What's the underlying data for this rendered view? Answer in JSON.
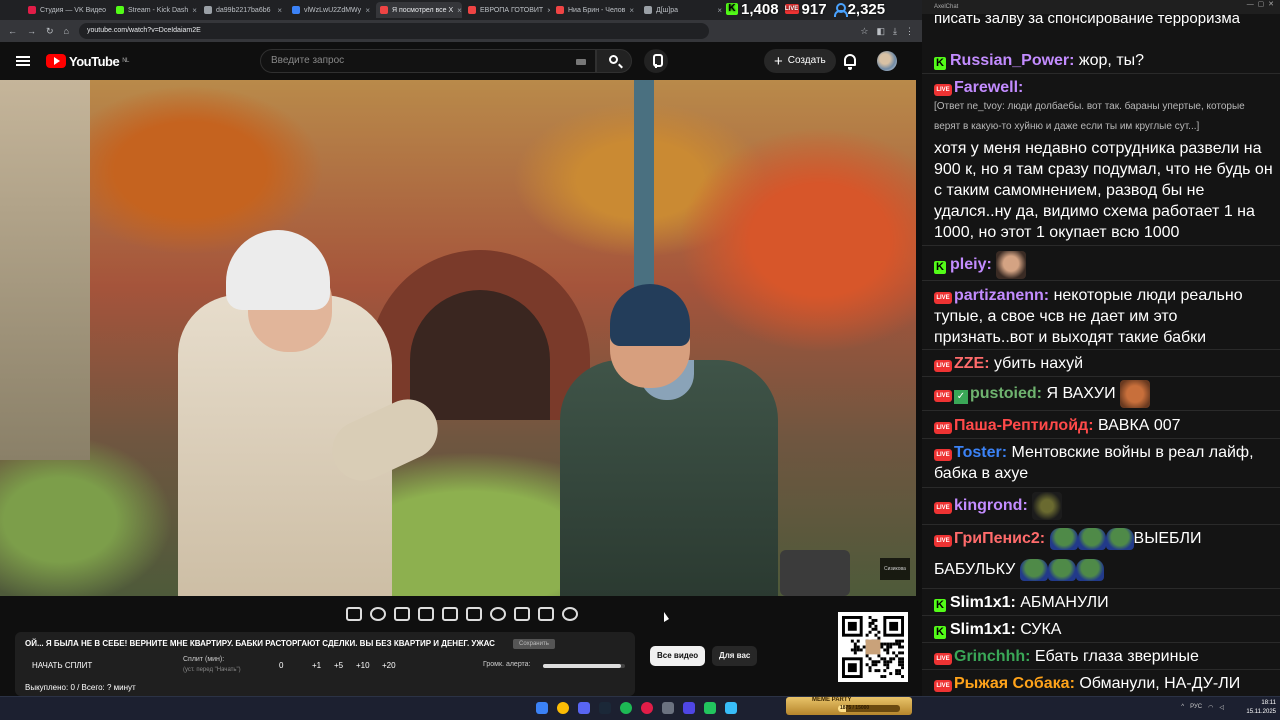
{
  "browser": {
    "tabs": [
      {
        "label": "Студия — VK Видео",
        "color": "#e11d48",
        "active": false
      },
      {
        "label": "Stream - Kick Dash",
        "color": "#53fc18",
        "active": false
      },
      {
        "label": "da99b2217ba6b6",
        "color": "#9aa0a6",
        "active": false
      },
      {
        "label": "vlWzLwU2ZdMWy",
        "color": "#3b82f6",
        "active": false
      },
      {
        "label": "Я посмотрел все Х",
        "color": "#ef4444",
        "active": true
      },
      {
        "label": "ЕВРОПА ГОТОВИТ",
        "color": "#ef4444",
        "active": false
      },
      {
        "label": "Ниа Брин - Челов",
        "color": "#ef4444",
        "active": false
      },
      {
        "label": "Д[ш]ра",
        "color": "#9aa0a6",
        "active": false
      }
    ],
    "url": "youtube.com/watch?v=DceIdaiam2E"
  },
  "stats": {
    "kick_viewers": "1,408",
    "live_viewers": "917",
    "total_viewers": "2,325"
  },
  "youtube": {
    "logo_text": "YouTube",
    "region": "NL",
    "search_placeholder": "Введите запрос",
    "create_label": "Создать"
  },
  "video": {
    "watermark": "Сизикова"
  },
  "panel": {
    "title": "ОЙ... Я БЫЛА НЕ В СЕБЕ! ВЕРНИТЕ МНЕ КВАРТИРУ. БАБКИ РАСТОРГАЮТ СДЕЛКИ. ВЫ БЕЗ КВАРТИР И ДЕНЕГ. УЖАС",
    "saved_button": "Сохранить",
    "split_button": "НАЧАТЬ СПЛИТ",
    "split_label": "Сплит (мин):",
    "split_sub": "(уст. перед \"Начать\")",
    "split_value": "0",
    "increments": [
      "+1",
      "+5",
      "+10",
      "+20"
    ],
    "volume_label": "Громк. алерта:",
    "volume_level": 0.95,
    "bought": "Выкуплено: 0 / Всего: ? минут"
  },
  "chips": {
    "all": "Все видео",
    "for_you": "Для вас"
  },
  "chat": {
    "window_title": "AxelChat",
    "top_cut": "писать залву за спонсирование терроризма",
    "messages": [
      {
        "badge": "kick",
        "user": "Russian_Power:",
        "color": "#c38cff",
        "text": " жор, ты?"
      },
      {
        "badge": "live",
        "user": "Farewell:",
        "color": "#c38cff",
        "text": ""
      },
      {
        "badge": "live",
        "user": "pleiy:",
        "color": "#c38cff",
        "text": ""
      },
      {
        "badge": "live",
        "user": "partizanenn:",
        "color": "#c38cff",
        "text": " некоторые люди реально тупые, а свое чсв не дает им это признать..вот и выходят такие бабки"
      },
      {
        "badge": "live",
        "user": "ZZE:",
        "color": "#ff6b6b",
        "text": " убить нахуй"
      },
      {
        "badge": "live",
        "user": "pustoied:",
        "color": "#6fb36f",
        "text": " Я ВАХУИ"
      },
      {
        "badge": "live",
        "user": "Паша-Рептилойд:",
        "color": "#ff4a4a",
        "text": " ВАВКА 007"
      },
      {
        "badge": "live",
        "user": "Toster:",
        "color": "#3b82f6",
        "text": " Ментовские войны в реал лайф, бабка в ахуе"
      },
      {
        "badge": "live",
        "user": "kingrond:",
        "color": "#c38cff",
        "text": ""
      },
      {
        "badge": "live",
        "user": "ГриПенис2:",
        "color": "#ff6b6b",
        "text": "ВЫЕБЛИ"
      },
      {
        "badge": "kick",
        "user": "Slim1x1:",
        "color": "#fff",
        "text": " АБМАНУЛИ"
      },
      {
        "badge": "kick",
        "user": "Slim1x1:",
        "color": "#fff",
        "text": " СУКА"
      },
      {
        "badge": "live",
        "user": "Grinchhh:",
        "color": "#3aa757",
        "text": " Ебать глаза звериные"
      },
      {
        "badge": "live",
        "user": "Рыжая Собака:",
        "color": "#ffa31a",
        "text": " Обманули, НА-ДУ-ЛИ"
      }
    ],
    "reply": "[Ответ ne_tvoy: люди долбаебы. вот так. бараны упертые, которые верят в какую-то хуйню и даже если ты им круглые сут...]",
    "farewell_text": "хотя у меня недавно сотрудника развели на 900 к, но я там сразу подумал, что не будь он с таким самомнением, развод бы не удался..ну да, видимо схема работает 1 на 1000, но этот 1 окупает всю 1000",
    "gri_continuation": "БАБУЛЬКУ"
  },
  "taskbar": {
    "meme_title": "MEME PARTY",
    "meme_count": "1875 / 15000",
    "meme_progress": 0.125,
    "lang": "РУС",
    "time": "18:11",
    "date": "15.11.2025"
  }
}
